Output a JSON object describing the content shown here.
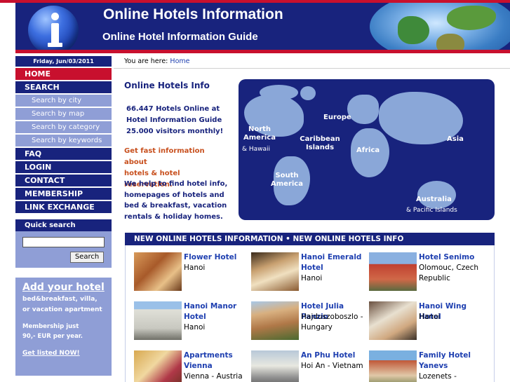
{
  "header": {
    "title": "Online Hotels Information",
    "subtitle": "Online Hotel Information Guide"
  },
  "sidebar": {
    "date": "Friday, Jun/03/2011",
    "nav": [
      {
        "label": "HOME"
      },
      {
        "label": "SEARCH"
      },
      {
        "label": "Search by city"
      },
      {
        "label": "Search by map"
      },
      {
        "label": "Search by category"
      },
      {
        "label": "Search by keywords"
      },
      {
        "label": "FAQ"
      },
      {
        "label": "LOGIN"
      },
      {
        "label": "CONTACT"
      },
      {
        "label": "MEMBERSHIP"
      },
      {
        "label": "LINK EXCHANGE"
      }
    ],
    "quick_search": {
      "title": "Quick search",
      "input_value": "",
      "button_label": "Search"
    },
    "add_hotel": {
      "title": "Add your hotel",
      "desc1": "bed&breakfast, villa,",
      "desc2": "or vacation apartment",
      "member1": "Membership just",
      "member2": "90,- EUR per year.",
      "link": "Get listed NOW!"
    }
  },
  "breadcrumb": {
    "prefix": "You are here:",
    "home": "Home"
  },
  "info": {
    "title": "Online Hotels Info",
    "stats1": "66.447 Hotels Online at",
    "stats2": "Hotel Information Guide",
    "stats3": "25.000 visitors monthly!",
    "fast1": "Get fast information about",
    "fast2": "hotels & hotel reservation.",
    "help1": "We help to find hotel info,",
    "help2": "homepages of hotels and",
    "help3": "bed & breakfast, vacation",
    "help4": "rentals & holiday homes."
  },
  "map": {
    "north_america": "North America",
    "hawaii": "& Hawaii",
    "caribbean": "Caribbean Islands",
    "europe": "Europe",
    "africa": "Africa",
    "asia": "Asia",
    "south_america": "South America",
    "australia": "Australia",
    "pacific": "& Pacific Islands"
  },
  "new_hotels": {
    "heading": "NEW ONLINE HOTELS INFORMATION • NEW ONLINE HOTELS INFO",
    "items": [
      {
        "name": "Flower Hotel",
        "location": "Hanoi"
      },
      {
        "name": "Hanoi Emerald Hotel",
        "location": "Hanoi"
      },
      {
        "name": "Hotel Senimo",
        "location": "Olomouc, Czech Republic"
      },
      {
        "name": "Hanoi Manor Hotel",
        "location": "Hanoi"
      },
      {
        "name": "Hotel Julia Panzio",
        "location": "Hajduszoboszlo - Hungary"
      },
      {
        "name": "Hanoi Wing Hotel",
        "location": "Hanoi"
      },
      {
        "name": "Apartments Vienna",
        "location": "Vienna - Austria"
      },
      {
        "name": "An Phu Hotel",
        "location": "Hoi An - Vietnam"
      },
      {
        "name": "Family Hotel Yanevs",
        "location": "Lozenets -"
      }
    ]
  },
  "colors": {
    "navy": "#18237d",
    "red": "#c8102e",
    "lavender": "#8f9ed6",
    "link_blue": "#1e3fb0",
    "orange_text": "#c8501e"
  }
}
